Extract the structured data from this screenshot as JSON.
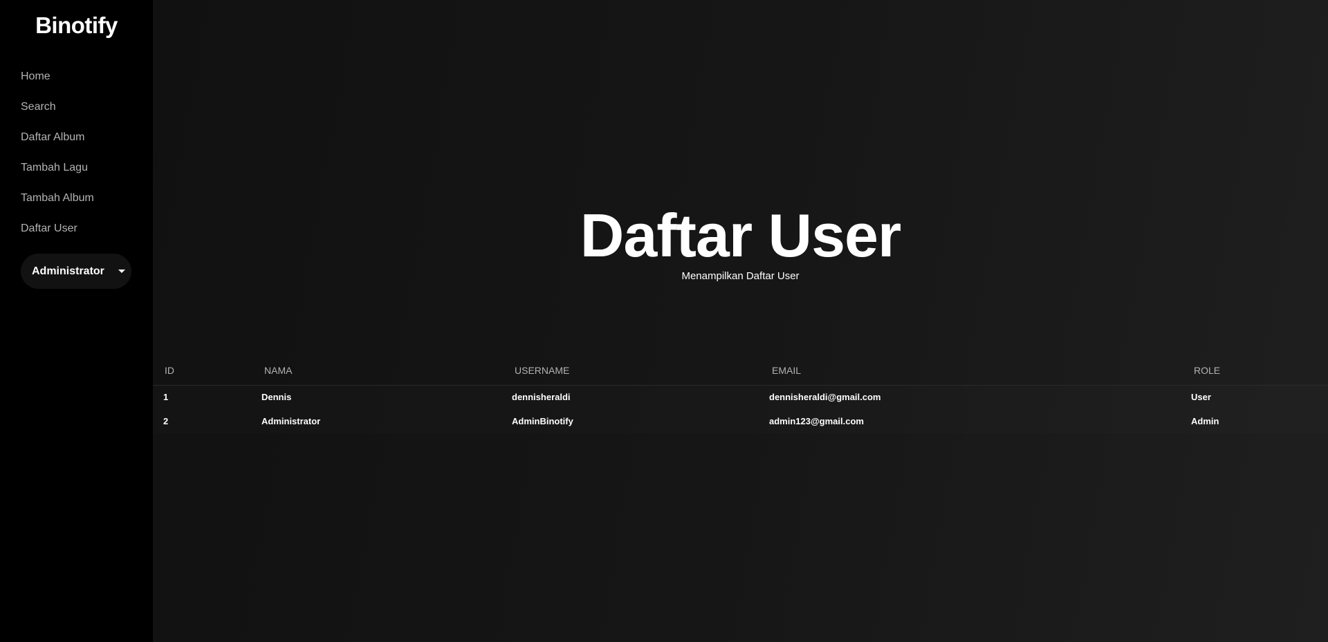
{
  "app": {
    "logo": "Binotify"
  },
  "sidebar": {
    "items": [
      {
        "label": "Home"
      },
      {
        "label": "Search"
      },
      {
        "label": "Daftar Album"
      },
      {
        "label": "Tambah Lagu"
      },
      {
        "label": "Tambah Album"
      },
      {
        "label": "Daftar User"
      }
    ],
    "user_menu": {
      "label": "Administrator",
      "icon": "caret-down-icon"
    }
  },
  "main": {
    "title": "Daftar User",
    "subtitle": "Menampilkan Daftar User",
    "table": {
      "headers": [
        "ID",
        "NAMA",
        "USERNAME",
        "EMAIL",
        "ROLE"
      ],
      "rows": [
        [
          "1",
          "Dennis",
          "dennisheraldi",
          "dennisheraldi@gmail.com",
          "User"
        ],
        [
          "2",
          "Administrator",
          "AdminBinotify",
          "admin123@gmail.com",
          "Admin"
        ]
      ]
    }
  }
}
